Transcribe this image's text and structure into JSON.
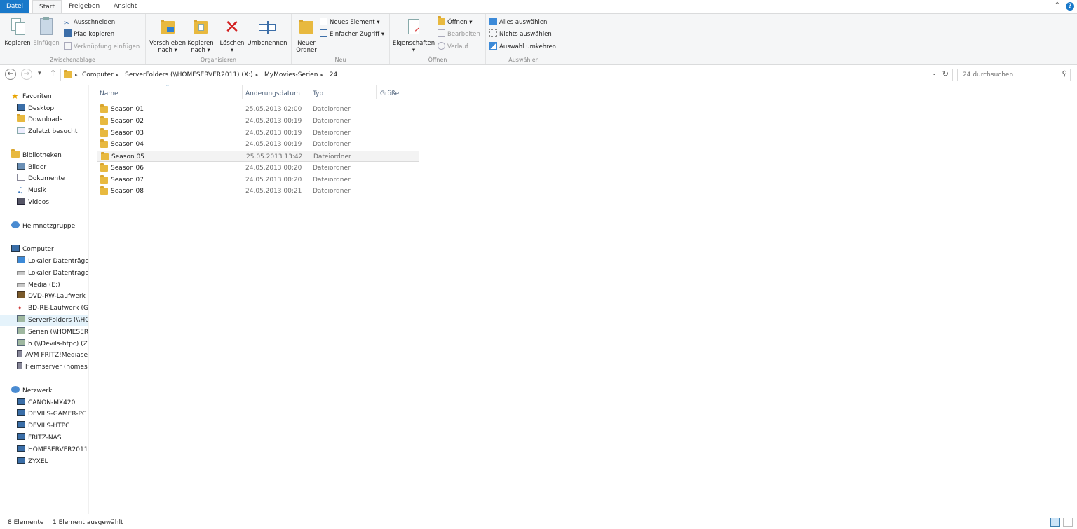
{
  "tabs": {
    "file": "Datei",
    "home": "Start",
    "share": "Freigeben",
    "view": "Ansicht"
  },
  "ribbon": {
    "clipboard": {
      "label": "Zwischenablage",
      "copy": "Kopieren",
      "paste": "Einfügen",
      "cut": "Ausschneiden",
      "copy_path": "Pfad kopieren",
      "paste_shortcut": "Verknüpfung einfügen"
    },
    "organize": {
      "label": "Organisieren",
      "move_to_1": "Verschieben",
      "move_to_2": "nach ▾",
      "copy_to_1": "Kopieren",
      "copy_to_2": "nach ▾",
      "delete_1": "Löschen",
      "delete_2": "▾",
      "rename": "Umbenennen"
    },
    "new": {
      "label": "Neu",
      "new_folder_1": "Neuer",
      "new_folder_2": "Ordner",
      "new_item": "Neues Element ▾",
      "easy_access": "Einfacher Zugriff ▾"
    },
    "open": {
      "label": "Öffnen",
      "properties_1": "Eigenschaften",
      "properties_2": "▾",
      "open": "Öffnen ▾",
      "edit": "Bearbeiten",
      "history": "Verlauf"
    },
    "select": {
      "label": "Auswählen",
      "select_all": "Alles auswählen",
      "select_none": "Nichts auswählen",
      "invert": "Auswahl umkehren"
    }
  },
  "address": {
    "crumbs": [
      "Computer",
      "ServerFolders (\\\\HOMESERVER2011) (X:)",
      "MyMovies-Serien",
      "24"
    ],
    "search_placeholder": "24 durchsuchen"
  },
  "nav": {
    "favorites": "Favoriten",
    "desktop": "Desktop",
    "downloads": "Downloads",
    "recent": "Zuletzt besucht",
    "libraries": "Bibliotheken",
    "pictures": "Bilder",
    "documents": "Dokumente",
    "music": "Musik",
    "videos": "Videos",
    "homegroup": "Heimnetzgruppe",
    "computer": "Computer",
    "local1": "Lokaler Datenträger",
    "local2": "Lokaler Datenträger",
    "media": "Media (E:)",
    "dvd": "DVD-RW-Laufwerk (",
    "bd": "BD-RE-Laufwerk (G:)",
    "serverfolders": "ServerFolders (\\\\HO",
    "serien": "Serien (\\\\HOMESERV",
    "h": "h (\\\\Devils-htpc) (Z:",
    "avm": "AVM FRITZ!Mediase",
    "heimserver": "Heimserver (homese",
    "network": "Netzwerk",
    "net1": "CANON-MX420",
    "net2": "DEVILS-GAMER-PC",
    "net3": "DEVILS-HTPC",
    "net4": "FRITZ-NAS",
    "net5": "HOMESERVER2011",
    "net6": "ZYXEL"
  },
  "columns": {
    "name": "Name",
    "date": "Änderungsdatum",
    "type": "Typ",
    "size": "Größe"
  },
  "files": [
    {
      "name": "Season 01",
      "date": "25.05.2013 02:00",
      "type": "Dateiordner"
    },
    {
      "name": "Season 02",
      "date": "24.05.2013 00:19",
      "type": "Dateiordner"
    },
    {
      "name": "Season 03",
      "date": "24.05.2013 00:19",
      "type": "Dateiordner"
    },
    {
      "name": "Season 04",
      "date": "24.05.2013 00:19",
      "type": "Dateiordner"
    },
    {
      "name": "Season 05",
      "date": "25.05.2013 13:42",
      "type": "Dateiordner"
    },
    {
      "name": "Season 06",
      "date": "24.05.2013 00:20",
      "type": "Dateiordner"
    },
    {
      "name": "Season 07",
      "date": "24.05.2013 00:20",
      "type": "Dateiordner"
    },
    {
      "name": "Season 08",
      "date": "24.05.2013 00:21",
      "type": "Dateiordner"
    }
  ],
  "status": {
    "count": "8 Elemente",
    "selected": "1 Element ausgewählt"
  },
  "colors": {
    "accent": "#1979ca",
    "folder": "#e8b93f",
    "selection": "#e5f3fb"
  }
}
